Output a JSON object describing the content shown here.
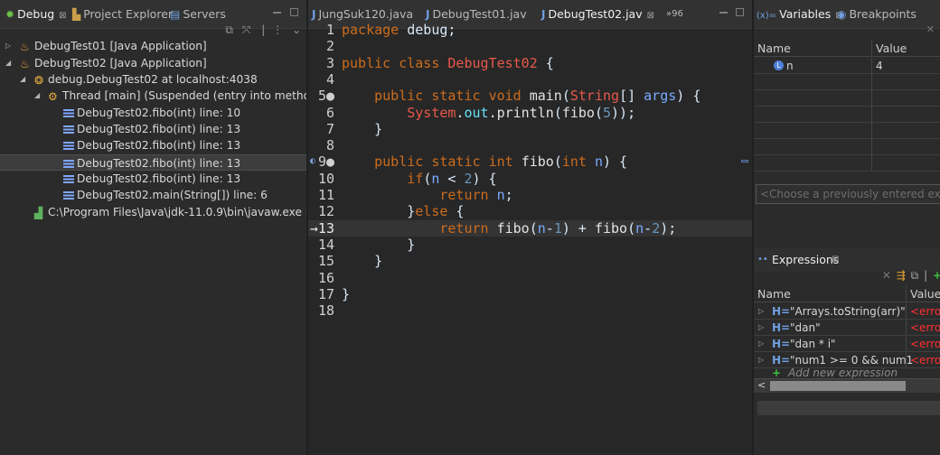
{
  "debug_view": {
    "tabs": [
      {
        "label": "Debug",
        "icon": "bug-icon",
        "close": "⊠"
      },
      {
        "label": "Project Explorer",
        "icon": "project-explorer-icon"
      },
      {
        "label": "Servers",
        "icon": "servers-icon"
      }
    ],
    "tree": [
      {
        "label": "DebugTest01 [Java Application]",
        "icon": "java-app-icon",
        "expander": "▷"
      },
      {
        "label": "DebugTest02 [Java Application]",
        "icon": "java-app-icon",
        "expander": "◢"
      },
      {
        "label": "debug.DebugTest02 at localhost:4038",
        "icon": "vm-icon",
        "expander": "◢"
      },
      {
        "label": "Thread [main] (Suspended (entry into method fib",
        "icon": "thread-suspended-icon",
        "expander": "◢"
      },
      {
        "label": "DebugTest02.fibo(int) line: 10",
        "icon": "stack-frame-icon"
      },
      {
        "label": "DebugTest02.fibo(int) line: 13",
        "icon": "stack-frame-icon"
      },
      {
        "label": "DebugTest02.fibo(int) line: 13",
        "icon": "stack-frame-icon"
      },
      {
        "label": "DebugTest02.fibo(int) line: 13",
        "icon": "stack-frame-icon",
        "selected": true
      },
      {
        "label": "DebugTest02.fibo(int) line: 13",
        "icon": "stack-frame-icon"
      },
      {
        "label": "DebugTest02.main(String[]) line: 6",
        "icon": "stack-frame-icon"
      },
      {
        "label": "C:\\Program Files\\Java\\jdk-11.0.9\\bin\\javaw.exe (2",
        "icon": "process-icon"
      }
    ]
  },
  "editor": {
    "tabs": [
      {
        "label": "JungSuk120.java",
        "icon": "J"
      },
      {
        "label": "DebugTest01.jav",
        "icon": "J"
      },
      {
        "label": "DebugTest02.jav",
        "icon": "J",
        "active": true,
        "close": "⊠"
      },
      {
        "label": "»96"
      }
    ],
    "line_numbers": [
      "1",
      "2",
      "3",
      "4",
      "5●",
      "6",
      "7",
      "8",
      "9●",
      "10",
      "11",
      "12",
      "→13",
      "14",
      "15",
      "16",
      "17",
      "18"
    ],
    "current_line_index": 12
  },
  "variables_view": {
    "tabs": [
      {
        "label": "Variables",
        "icon": "(x)=",
        "close": "⊠"
      },
      {
        "label": "Breakpoints",
        "icon": "breakpoints-icon"
      }
    ],
    "columns": [
      "Name",
      "Value"
    ],
    "rows": [
      {
        "name": "n",
        "value": "4"
      }
    ],
    "details_placeholder": "<Choose a previously entered express"
  },
  "expressions_view": {
    "title": "Expressions",
    "close": "⊠",
    "columns": [
      "Name",
      "Value"
    ],
    "rows": [
      {
        "name": "\"Arrays.toString(arr)\"",
        "value": "<erro"
      },
      {
        "name": "\"dan\"",
        "value": "<erro"
      },
      {
        "name": "\"dan * i\"",
        "value": "<erro"
      },
      {
        "name": "\"num1 >= 0 && num1",
        "value": "<erro"
      }
    ],
    "add_new": "Add new expression",
    "scroll_left": "<"
  }
}
